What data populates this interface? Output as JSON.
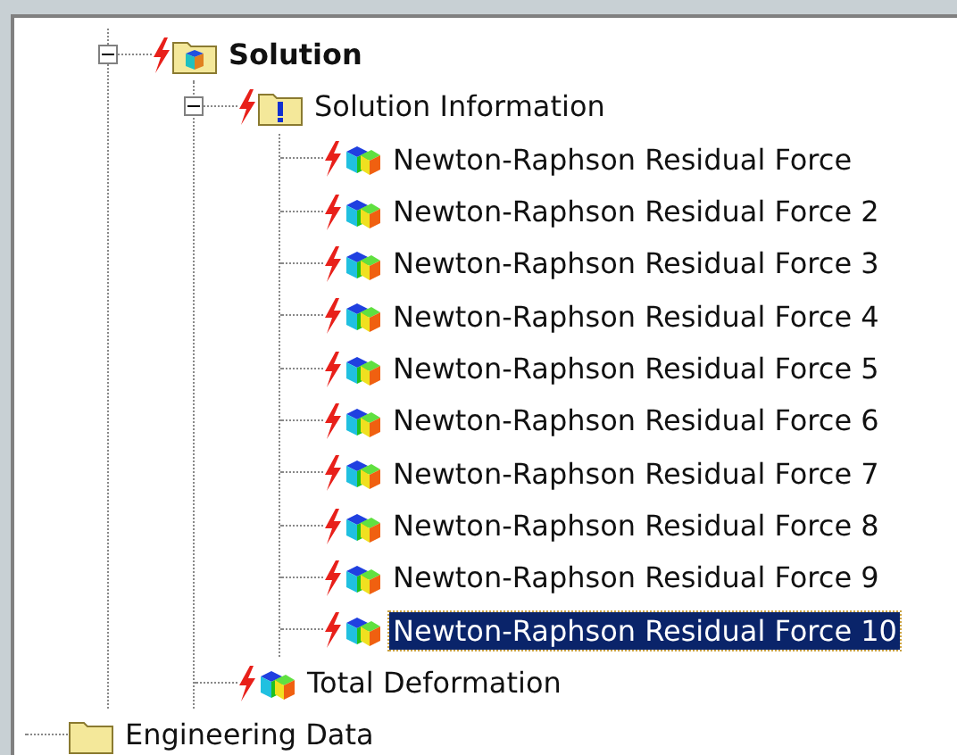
{
  "tree": {
    "partial_branch": [
      {
        "label": "Solution",
        "kind": "solution-folder",
        "outdated": true,
        "selected": false,
        "expanded": true,
        "children": [
          {
            "label": "Solution Information",
            "kind": "info-folder",
            "outdated": true,
            "selected": false,
            "expanded": true,
            "children": [
              {
                "label": "Newton-Raphson Residual Force",
                "kind": "result",
                "outdated": true,
                "selected": false
              },
              {
                "label": "Newton-Raphson Residual Force 2",
                "kind": "result",
                "outdated": true,
                "selected": false
              },
              {
                "label": "Newton-Raphson Residual Force 3",
                "kind": "result",
                "outdated": true,
                "selected": false
              },
              {
                "label": "Newton-Raphson Residual Force 4",
                "kind": "result",
                "outdated": true,
                "selected": false
              },
              {
                "label": "Newton-Raphson Residual Force 5",
                "kind": "result",
                "outdated": true,
                "selected": false
              },
              {
                "label": "Newton-Raphson Residual Force 6",
                "kind": "result",
                "outdated": true,
                "selected": false
              },
              {
                "label": "Newton-Raphson Residual Force 7",
                "kind": "result",
                "outdated": true,
                "selected": false
              },
              {
                "label": "Newton-Raphson Residual Force 8",
                "kind": "result",
                "outdated": true,
                "selected": false
              },
              {
                "label": "Newton-Raphson Residual Force 9",
                "kind": "result",
                "outdated": true,
                "selected": false
              },
              {
                "label": "Newton-Raphson Residual Force 10",
                "kind": "result",
                "outdated": true,
                "selected": true
              }
            ]
          },
          {
            "label": "Total Deformation",
            "kind": "result",
            "outdated": true,
            "selected": false
          }
        ]
      }
    ],
    "items": [
      {
        "label": "Engineering Data",
        "kind": "folder",
        "outdated": false,
        "selected": false
      }
    ]
  }
}
